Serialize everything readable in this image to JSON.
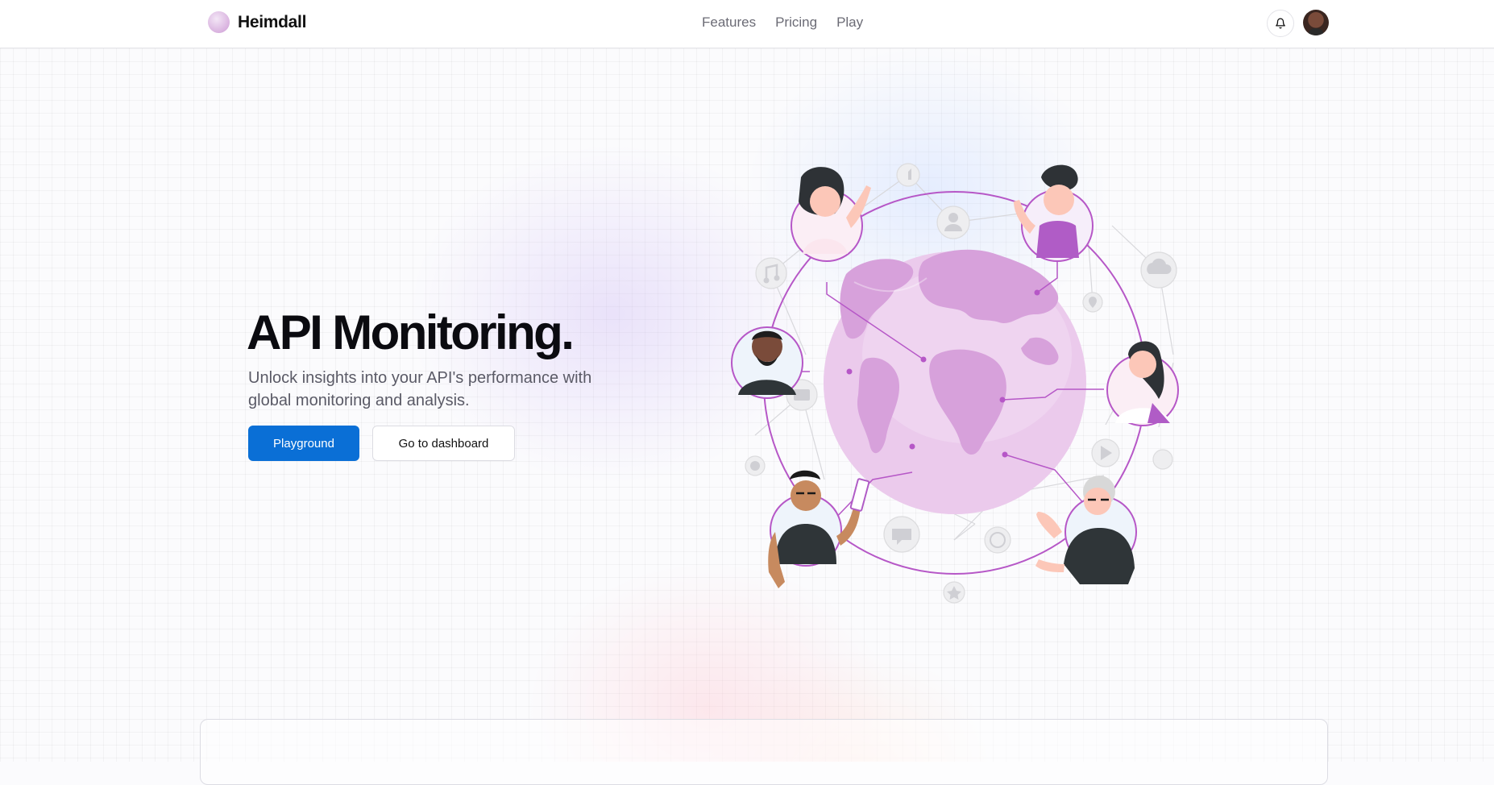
{
  "app": {
    "name": "Heimdall"
  },
  "nav": {
    "links": [
      {
        "label": "Features"
      },
      {
        "label": "Pricing"
      },
      {
        "label": "Play"
      }
    ]
  },
  "hero": {
    "title": "API Monitoring.",
    "subtitle": "Unlock insights into your API's performance with global monitoring and analysis.",
    "primary_button": "Playground",
    "secondary_button": "Go to dashboard"
  },
  "icons": {
    "logo": "globe-logo-icon",
    "bell": "bell-icon",
    "avatar": "user-avatar"
  },
  "colors": {
    "primary": "#0a6fd6",
    "accent": "#b05cc6",
    "globe": "#e3b6e6"
  }
}
